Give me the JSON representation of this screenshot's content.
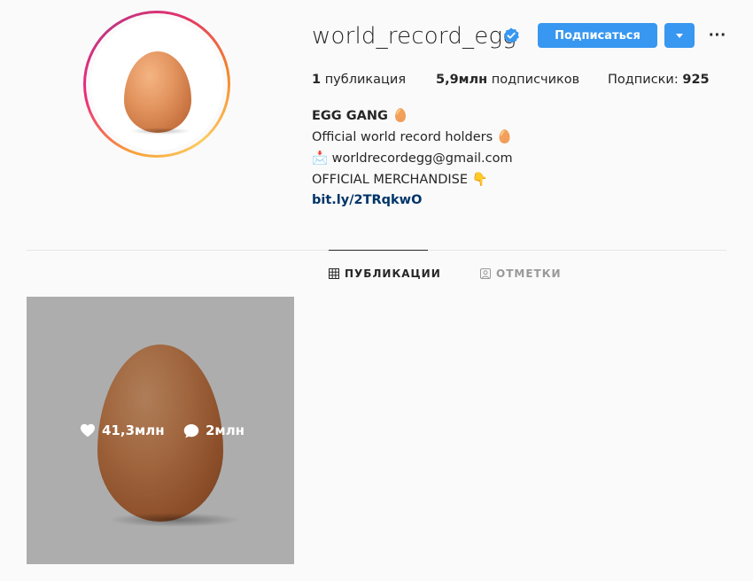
{
  "profile": {
    "username": "world_record_egg",
    "verified": true,
    "follow_label": "Подписаться",
    "more_label": "···"
  },
  "stats": {
    "posts_value": "1",
    "posts_label": "публикация",
    "followers_value": "5,9млн",
    "followers_label": "подписчиков",
    "following_label": "Подписки:",
    "following_value": "925"
  },
  "bio": {
    "name": "EGG GANG 🥚",
    "line1": "Official world record holders 🥚",
    "line2": "📩 worldrecordegg@gmail.com",
    "line3": "OFFICIAL MERCHANDISE 👇",
    "link": "bit.ly/2TRqkwO"
  },
  "tabs": [
    {
      "label": "ПУБЛИКАЦИИ",
      "icon": "grid-icon",
      "active": true
    },
    {
      "label": "ОТМЕТКИ",
      "icon": "tagged-icon",
      "active": false
    }
  ],
  "posts": [
    {
      "likes": "41,3млн",
      "comments": "2млн"
    }
  ],
  "colors": {
    "accent": "#3897f0",
    "background": "#fafafa",
    "link": "#003569",
    "verified": "#3897f0"
  }
}
